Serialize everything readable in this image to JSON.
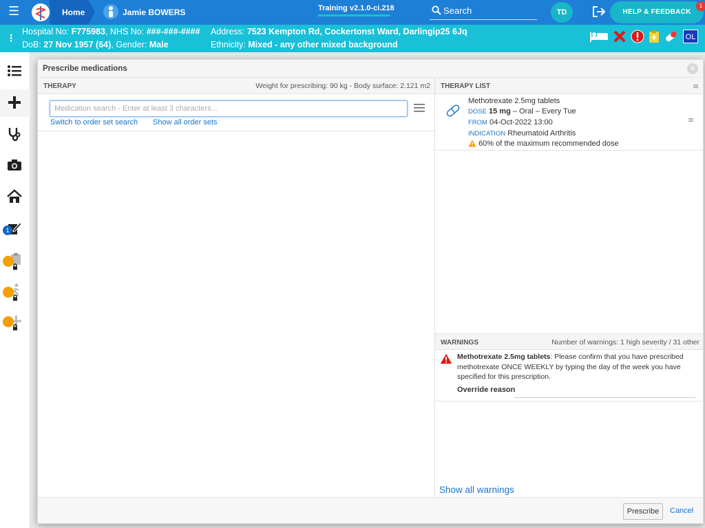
{
  "topbar": {
    "home_label": "Home",
    "patient_name": "Jamie BOWERS",
    "version": "Training v2.1.0-ci.218",
    "search_label": "Search",
    "user_initials": "TD",
    "help_label": "HELP & FEEDBACK",
    "help_badge": "1",
    "accent": "#1e7fd6"
  },
  "banner": {
    "hospital_no_label": "Hospital No:",
    "hospital_no": "F775983",
    "nhs_no_label": "NHS No:",
    "nhs_no": "###-###-####",
    "address_label": "Address:",
    "address": "7523 Kempton Rd, Cockertonst Ward, Darlingip25 6Jq",
    "dob_label": "DoB:",
    "dob": "27 Nov 1957 (64)",
    "gender_label": "Gender:",
    "gender": "Male",
    "ethnicity_label": "Ethnicity:",
    "ethnicity": "Mixed - any other mixed background",
    "ol_label": "OL",
    "color": "#18c0d8"
  },
  "sidebar": {
    "badge_count": "1",
    "icons": [
      "list-icon",
      "plus-icon",
      "stethoscope-icon",
      "camera-icon",
      "home-icon",
      "edit-document-icon",
      "clipboard-icon",
      "walking-icon",
      "add-icon"
    ]
  },
  "dialog": {
    "title": "Prescribe medications",
    "therapy": {
      "header": "THERAPY",
      "weight_info": "Weight for prescribing: 90 kg - Body surface: 2.121 m2",
      "search_placeholder": "Medication search - Enter at least 3 characters...",
      "switch_link": "Switch to order set search",
      "show_sets_link": "Show all order sets"
    },
    "therapy_list": {
      "header": "THERAPY LIST",
      "item": {
        "name": "Methotrexate 2.5mg tablets",
        "dose_label": "DOSE",
        "dose_amount": "15 mg",
        "dose_route": "– Oral – Every Tue",
        "from_label": "FROM",
        "from_value": "04-Oct-2022 13:00",
        "indication_label": "INDICATION",
        "indication_value": "Rheumatoid Arthritis",
        "dose_warning": "60% of the maximum recommended dose"
      }
    },
    "warnings": {
      "header": "WARNINGS",
      "count_text": "Number of warnings: 1 high severity / 31 other",
      "warning_drug": "Methotrexate 2.5mg tablets",
      "warning_text": ": Please confirm that you have prescribed methotrexate ONCE WEEKLY by typing the day of the week you have specified for this prescription.",
      "override_label": "Override reason",
      "show_all": "Show all warnings"
    },
    "footer": {
      "prescribe": "Prescribe",
      "cancel": "Cancel"
    }
  }
}
